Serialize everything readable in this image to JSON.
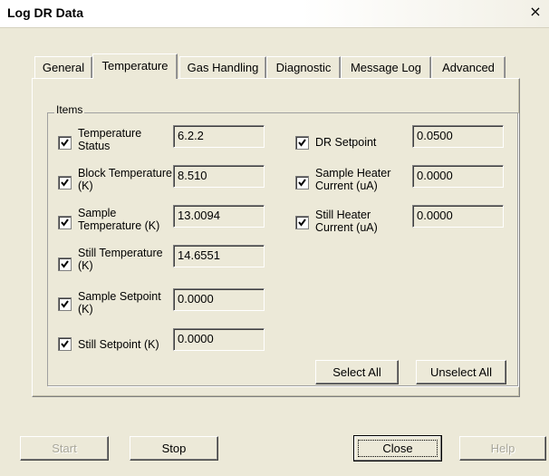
{
  "window": {
    "title": "Log DR Data",
    "close_glyph": "×"
  },
  "tabs": [
    {
      "label": "General",
      "active": false
    },
    {
      "label": "Temperature",
      "active": true
    },
    {
      "label": "Gas Handling",
      "active": false
    },
    {
      "label": "Diagnostic",
      "active": false
    },
    {
      "label": "Message Log",
      "active": false
    },
    {
      "label": "Advanced",
      "active": false
    }
  ],
  "items_group": {
    "label": "Items",
    "left_items": [
      {
        "label": "Temperature Status",
        "value": "6.2.2",
        "checked": true
      },
      {
        "label": "Block Temperature (K)",
        "value": "8.510",
        "checked": true
      },
      {
        "label": "Sample Temperature (K)",
        "value": "13.0094",
        "checked": true
      },
      {
        "label": "Still Temperature (K)",
        "value": "14.6551",
        "checked": true
      },
      {
        "label": "Sample Setpoint (K)",
        "value": "0.0000",
        "checked": true
      },
      {
        "label": "Still Setpoint (K)",
        "value": "0.0000",
        "checked": true
      }
    ],
    "right_items": [
      {
        "label": "DR Setpoint",
        "value": "0.0500",
        "checked": true
      },
      {
        "label": "Sample Heater Current (uA)",
        "value": "0.0000",
        "checked": true
      },
      {
        "label": "Still Heater Current (uA)",
        "value": "0.0000",
        "checked": true
      }
    ],
    "select_all_label": "Select All",
    "unselect_all_label": "Unselect All"
  },
  "buttons": {
    "start": {
      "label": "Start",
      "enabled": false
    },
    "stop": {
      "label": "Stop",
      "enabled": true
    },
    "close": {
      "label": "Close",
      "enabled": true
    },
    "help": {
      "label": "Help",
      "enabled": false
    }
  }
}
